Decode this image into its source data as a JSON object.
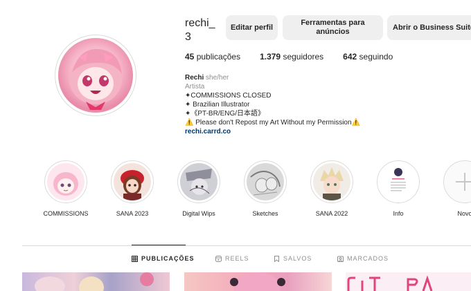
{
  "profile": {
    "username": "rechi_3",
    "buttons": {
      "edit": "Editar perfil",
      "tools": "Ferramentas para anúncios",
      "business": "Abrir o Business Suite"
    },
    "stats": {
      "posts_count": "45",
      "posts_label": "publicações",
      "followers_count": "1.379",
      "followers_label": "seguidores",
      "following_count": "642",
      "following_label": "seguindo"
    },
    "bio": {
      "name": "Rechi",
      "pronouns": "she/her",
      "category": "Artista",
      "line1": "✦COMMISSIONS CLOSED",
      "line2": "✦ Brazilian Illustrator",
      "line3": "✦《PT-BR/ENG/日本語》",
      "line4": "⚠️ Please don't Repost my Art Without my Permission⚠️",
      "link": "rechi.carrd.co"
    }
  },
  "highlights": [
    {
      "label": "COMMISSIONS",
      "icon": "pink-chibi"
    },
    {
      "label": "SANA 2023",
      "icon": "red-hair-girl"
    },
    {
      "label": "Digital Wips",
      "icon": "grey-sketch"
    },
    {
      "label": "Sketches",
      "icon": "pencil-sketch"
    },
    {
      "label": "SANA 2022",
      "icon": "blond-boy"
    },
    {
      "label": "Info",
      "icon": "info-card"
    },
    {
      "label": "Novo",
      "icon": "plus-icon"
    }
  ],
  "tabs": [
    {
      "label": "PUBLICAÇÕES",
      "icon": "grid-icon",
      "active": true
    },
    {
      "label": "REELS",
      "icon": "reels-icon",
      "active": false
    },
    {
      "label": "SALVOS",
      "icon": "bookmark-icon",
      "active": false
    },
    {
      "label": "MARCADOS",
      "icon": "tagged-icon",
      "active": false
    }
  ],
  "colors": {
    "button_bg": "#efefef",
    "link": "#00376b",
    "muted": "#8e8e8e",
    "border": "#dbdbdb"
  }
}
